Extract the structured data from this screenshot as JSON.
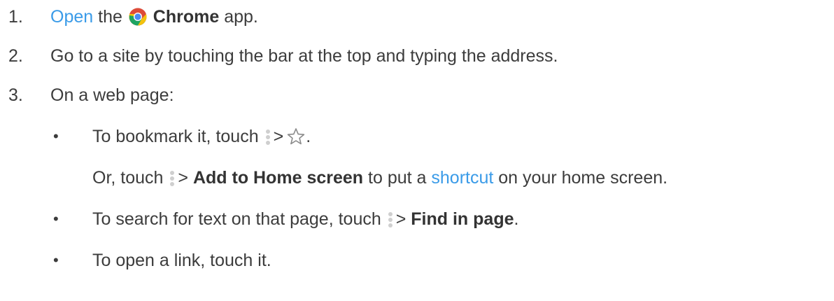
{
  "steps": [
    {
      "number": "1.",
      "link": "Open",
      "the": "the",
      "app_name": "Chrome",
      "suffix": "app."
    },
    {
      "number": "2.",
      "text": "Go to a site by touching the bar at the top and typing the address."
    },
    {
      "number": "3.",
      "text": "On a web page:"
    }
  ],
  "bullets": [
    {
      "marker": "•",
      "prefix": "To bookmark it, touch",
      "sep": ">",
      "end": "."
    },
    {
      "prefix": "Or, touch",
      "sep": ">",
      "bold": "Add to Home screen",
      "mid": "to put a",
      "link": "shortcut",
      "end": "on your home screen."
    },
    {
      "marker": "•",
      "prefix": "To search for text on that page, touch",
      "sep": ">",
      "bold": "Find in page",
      "end": "."
    },
    {
      "marker": "•",
      "text": "To open a link, touch it."
    }
  ],
  "colors": {
    "link": "#3a9be8",
    "text": "#3c3c3c"
  },
  "icons": {
    "chrome": "chrome-icon",
    "menu": "more-vert-icon",
    "star": "star-outline-icon"
  }
}
